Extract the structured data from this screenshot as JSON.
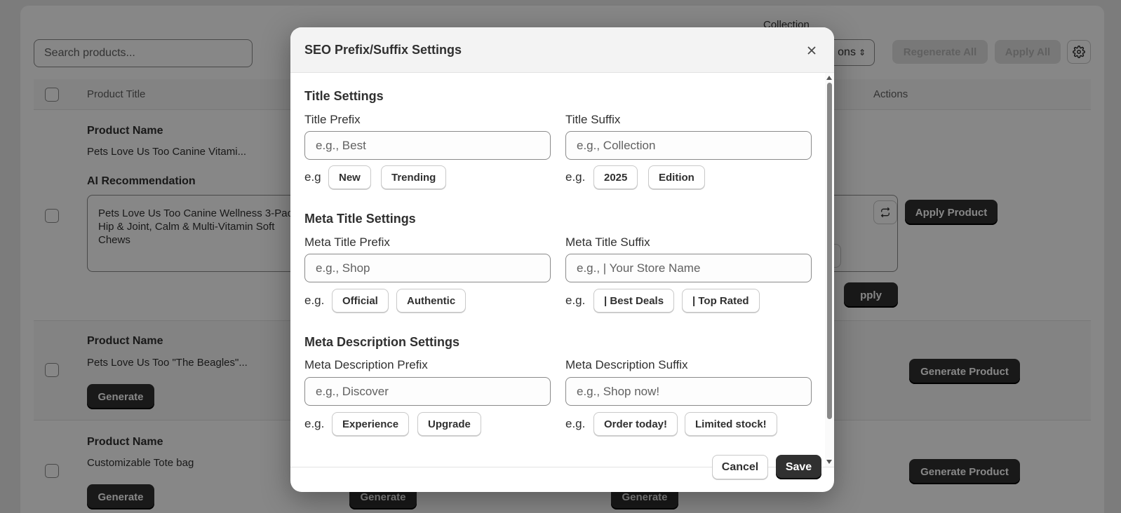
{
  "background": {
    "search_placeholder": "Search products...",
    "collection_label": "Collection",
    "collection_value": "ons",
    "regenerate_all": "Regenerate All",
    "apply_all": "Apply All",
    "table_headers": {
      "product_title": "Product Title",
      "actions": "Actions"
    },
    "rows": [
      {
        "name_label": "Product Name",
        "name": "Pets Love Us Too Canine Vitami...",
        "ai_label": "AI Recommendation",
        "ai_text": "Pets Love Us Too Canine Wellness 3-Pack: Hip & Joint, Calm & Multi-Vitamin Soft Chews",
        "apply_product": "Apply Product",
        "apply_partial": "pply"
      },
      {
        "name_label": "Product Name",
        "name": "Pets Love Us Too \"The Beagles\"...",
        "generate": "Generate",
        "generate_product": "Generate Product"
      },
      {
        "name_label": "Product Name",
        "name": "Customizable Tote bag",
        "generate": "Generate",
        "generate_product": "Generate Product"
      }
    ]
  },
  "modal": {
    "title": "SEO Prefix/Suffix Settings",
    "sections": {
      "title": {
        "heading": "Title Settings",
        "prefix_label": "Title Prefix",
        "prefix_placeholder": "e.g., Best",
        "prefix_eg": "e.g",
        "prefix_chips": [
          "New",
          "Trending"
        ],
        "suffix_label": "Title Suffix",
        "suffix_placeholder": "e.g., Collection",
        "suffix_eg": "e.g.",
        "suffix_chips": [
          "2025",
          "Edition"
        ]
      },
      "meta_title": {
        "heading": "Meta Title Settings",
        "prefix_label": "Meta Title Prefix",
        "prefix_placeholder": "e.g., Shop",
        "prefix_eg": "e.g.",
        "prefix_chips": [
          "Official",
          "Authentic"
        ],
        "suffix_label": "Meta Title Suffix",
        "suffix_placeholder": "e.g., | Your Store Name",
        "suffix_eg": "e.g.",
        "suffix_chips": [
          "| Best Deals",
          "| Top Rated"
        ]
      },
      "meta_description": {
        "heading": "Meta Description Settings",
        "prefix_label": "Meta Description Prefix",
        "prefix_placeholder": "e.g., Discover",
        "prefix_eg": "e.g.",
        "prefix_chips": [
          "Experience",
          "Upgrade"
        ],
        "suffix_label": "Meta Description Suffix",
        "suffix_placeholder": "e.g., Shop now!",
        "suffix_eg": "e.g.",
        "suffix_chips": [
          "Order today!",
          "Limited stock!"
        ]
      }
    },
    "cancel": "Cancel",
    "save": "Save"
  }
}
